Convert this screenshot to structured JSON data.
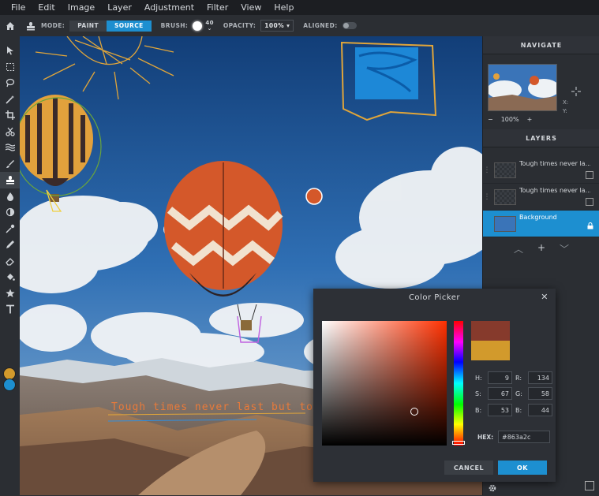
{
  "menu": [
    "File",
    "Edit",
    "Image",
    "Layer",
    "Adjustment",
    "Filter",
    "View",
    "Help"
  ],
  "toolbar": {
    "mode_label": "MODE:",
    "mode_paint": "PAINT",
    "mode_source": "SOURCE",
    "brush_label": "BRUSH:",
    "brush_size": "40",
    "opacity_label": "OPACITY:",
    "opacity_value": "100%",
    "aligned_label": "ALIGNED:"
  },
  "tools": [
    "select-arrow-icon",
    "marquee-icon",
    "lasso-icon",
    "magic-wand-icon",
    "crop-icon",
    "cut-icon",
    "liquify-icon",
    "brush-icon",
    "clone-stamp-icon",
    "drop-icon",
    "dodge-icon",
    "eyedropper-icon",
    "pencil-icon",
    "eraser-icon",
    "fill-icon",
    "star-icon",
    "text-icon"
  ],
  "colors": {
    "foreground": "#d29a2c",
    "background": "#1d8fd0",
    "accent": "#1d8fd0"
  },
  "canvas": {
    "overlay_text": "Tough times never last but tough"
  },
  "navigate": {
    "title": "NAVIGATE",
    "x_label": "X:",
    "y_label": "Y:",
    "zoom": "100%",
    "minus": "−",
    "plus": "+"
  },
  "layers": {
    "title": "LAYERS",
    "items": [
      {
        "name": "Tough times never la..."
      },
      {
        "name": "Tough times never la..."
      },
      {
        "name": "Background"
      }
    ]
  },
  "picker": {
    "title": "Color Picker",
    "close": "✕",
    "h": "9",
    "s": "67",
    "b": "53",
    "r": "134",
    "g": "58",
    "bl": "44",
    "h_label": "H:",
    "s_label": "S:",
    "b_label": "B:",
    "r_label": "R:",
    "g_label": "G:",
    "bl_label": "B:",
    "hex_label": "HEX:",
    "hex": "#863a2c",
    "cancel": "CANCEL",
    "ok": "OK",
    "current_color": "#863a2c",
    "previous_color": "#d29a2c"
  }
}
